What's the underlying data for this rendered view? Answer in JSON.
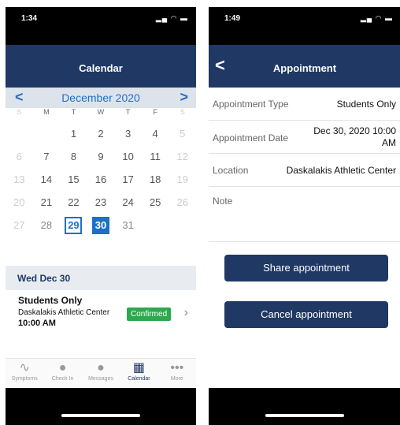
{
  "left": {
    "time": "1:34",
    "title": "Calendar",
    "month": "December 2020",
    "weekdays": [
      "S",
      "M",
      "T",
      "W",
      "T",
      "F",
      "S"
    ],
    "weeks": [
      [
        "",
        "",
        "1",
        "2",
        "3",
        "4",
        "5"
      ],
      [
        "6",
        "7",
        "8",
        "9",
        "10",
        "11",
        "12"
      ],
      [
        "13",
        "14",
        "15",
        "16",
        "17",
        "18",
        "19"
      ],
      [
        "20",
        "21",
        "22",
        "23",
        "24",
        "25",
        "26"
      ],
      [
        "27",
        "28",
        "29",
        "30",
        "31",
        "",
        ""
      ]
    ],
    "selected_day_header": "Wed Dec 30",
    "appointment": {
      "title": "Students Only",
      "location": "Daskalakis Athletic Center",
      "time": "10:00 AM",
      "status": "Confirmed"
    },
    "tabs": [
      {
        "label": "Symptoms",
        "icon": "symptoms-icon",
        "glyph": "∿"
      },
      {
        "label": "Check In",
        "icon": "location-pin-icon",
        "glyph": "●"
      },
      {
        "label": "Messages",
        "icon": "chat-bubble-icon",
        "glyph": "●"
      },
      {
        "label": "Calendar",
        "icon": "calendar-icon",
        "glyph": "▦"
      },
      {
        "label": "More",
        "icon": "more-dots-icon",
        "glyph": "•••"
      }
    ]
  },
  "right": {
    "time": "1:49",
    "title": "Appointment",
    "fields": {
      "type_label": "Appointment Type",
      "type_value": "Students Only",
      "date_label": "Appointment Date",
      "date_value_line1": "Dec 30, 2020 10:00",
      "date_value_line2": "AM",
      "location_label": "Location",
      "location_value": "Daskalakis Athletic Center",
      "note_label": "Note"
    },
    "share_label": "Share appointment",
    "cancel_label": "Cancel appointment"
  },
  "colors": {
    "navy": "#203864",
    "accent": "#1f6fc7",
    "confirmed": "#2ea84e"
  }
}
